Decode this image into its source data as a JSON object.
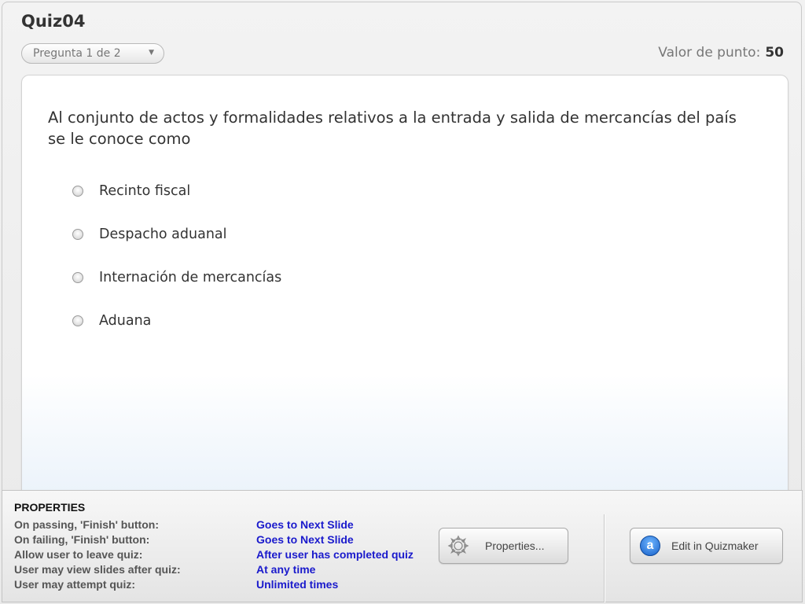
{
  "quiz": {
    "title": "Quiz04",
    "question_selector": "Pregunta 1 de 2",
    "point_value_label": "Valor de punto:",
    "point_value": "50"
  },
  "question": {
    "text": "Al conjunto de actos y formalidades relativos a la entrada y salida de mercancías del país se le conoce como",
    "options": [
      {
        "label": "Recinto fiscal",
        "selected": false
      },
      {
        "label": "Despacho aduanal",
        "selected": false
      },
      {
        "label": "Internación de mercancías",
        "selected": false
      },
      {
        "label": "Aduana",
        "selected": false
      }
    ]
  },
  "properties": {
    "heading": "PROPERTIES",
    "rows": [
      {
        "label": "On passing, 'Finish' button:",
        "value": "Goes to Next Slide"
      },
      {
        "label": "On failing, 'Finish' button:",
        "value": "Goes to Next Slide"
      },
      {
        "label": "Allow user to leave quiz:",
        "value": "After user has completed quiz"
      },
      {
        "label": "User may view slides after quiz:",
        "value": "At any time"
      },
      {
        "label": "User may attempt quiz:",
        "value": "Unlimited times"
      }
    ],
    "properties_button": "Properties...",
    "edit_button": "Edit in Quizmaker"
  },
  "icons": {
    "dropdown": "chevron-down-icon",
    "properties": "gear-icon",
    "quizmaker": "quizmaker-a-icon"
  },
  "colors": {
    "value_text": "#1a1acc",
    "label_text": "#555555"
  }
}
